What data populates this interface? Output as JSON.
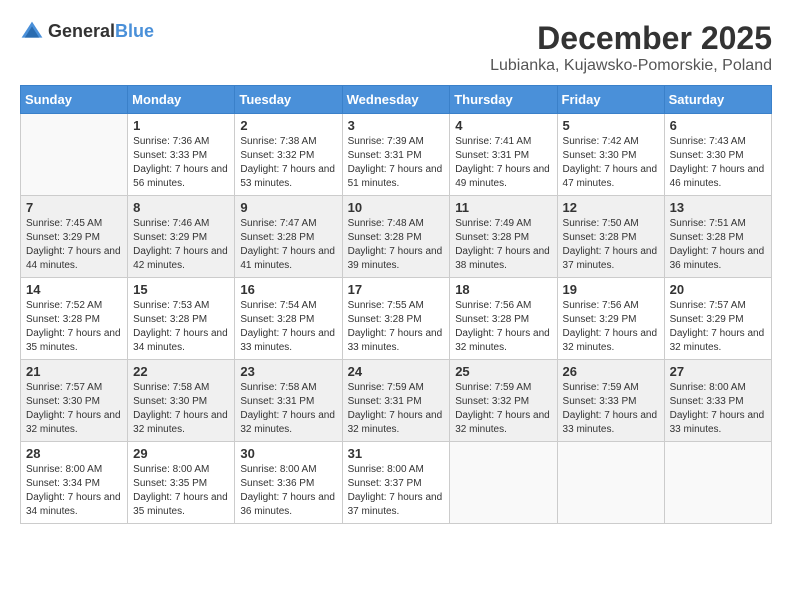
{
  "logo": {
    "general": "General",
    "blue": "Blue"
  },
  "title": "December 2025",
  "location": "Lubianka, Kujawsko-Pomorskie, Poland",
  "weekdays": [
    "Sunday",
    "Monday",
    "Tuesday",
    "Wednesday",
    "Thursday",
    "Friday",
    "Saturday"
  ],
  "weeks": [
    [
      {
        "day": null
      },
      {
        "day": 1,
        "sunrise": "Sunrise: 7:36 AM",
        "sunset": "Sunset: 3:33 PM",
        "daylight": "Daylight: 7 hours and 56 minutes."
      },
      {
        "day": 2,
        "sunrise": "Sunrise: 7:38 AM",
        "sunset": "Sunset: 3:32 PM",
        "daylight": "Daylight: 7 hours and 53 minutes."
      },
      {
        "day": 3,
        "sunrise": "Sunrise: 7:39 AM",
        "sunset": "Sunset: 3:31 PM",
        "daylight": "Daylight: 7 hours and 51 minutes."
      },
      {
        "day": 4,
        "sunrise": "Sunrise: 7:41 AM",
        "sunset": "Sunset: 3:31 PM",
        "daylight": "Daylight: 7 hours and 49 minutes."
      },
      {
        "day": 5,
        "sunrise": "Sunrise: 7:42 AM",
        "sunset": "Sunset: 3:30 PM",
        "daylight": "Daylight: 7 hours and 47 minutes."
      },
      {
        "day": 6,
        "sunrise": "Sunrise: 7:43 AM",
        "sunset": "Sunset: 3:30 PM",
        "daylight": "Daylight: 7 hours and 46 minutes."
      }
    ],
    [
      {
        "day": 7,
        "sunrise": "Sunrise: 7:45 AM",
        "sunset": "Sunset: 3:29 PM",
        "daylight": "Daylight: 7 hours and 44 minutes."
      },
      {
        "day": 8,
        "sunrise": "Sunrise: 7:46 AM",
        "sunset": "Sunset: 3:29 PM",
        "daylight": "Daylight: 7 hours and 42 minutes."
      },
      {
        "day": 9,
        "sunrise": "Sunrise: 7:47 AM",
        "sunset": "Sunset: 3:28 PM",
        "daylight": "Daylight: 7 hours and 41 minutes."
      },
      {
        "day": 10,
        "sunrise": "Sunrise: 7:48 AM",
        "sunset": "Sunset: 3:28 PM",
        "daylight": "Daylight: 7 hours and 39 minutes."
      },
      {
        "day": 11,
        "sunrise": "Sunrise: 7:49 AM",
        "sunset": "Sunset: 3:28 PM",
        "daylight": "Daylight: 7 hours and 38 minutes."
      },
      {
        "day": 12,
        "sunrise": "Sunrise: 7:50 AM",
        "sunset": "Sunset: 3:28 PM",
        "daylight": "Daylight: 7 hours and 37 minutes."
      },
      {
        "day": 13,
        "sunrise": "Sunrise: 7:51 AM",
        "sunset": "Sunset: 3:28 PM",
        "daylight": "Daylight: 7 hours and 36 minutes."
      }
    ],
    [
      {
        "day": 14,
        "sunrise": "Sunrise: 7:52 AM",
        "sunset": "Sunset: 3:28 PM",
        "daylight": "Daylight: 7 hours and 35 minutes."
      },
      {
        "day": 15,
        "sunrise": "Sunrise: 7:53 AM",
        "sunset": "Sunset: 3:28 PM",
        "daylight": "Daylight: 7 hours and 34 minutes."
      },
      {
        "day": 16,
        "sunrise": "Sunrise: 7:54 AM",
        "sunset": "Sunset: 3:28 PM",
        "daylight": "Daylight: 7 hours and 33 minutes."
      },
      {
        "day": 17,
        "sunrise": "Sunrise: 7:55 AM",
        "sunset": "Sunset: 3:28 PM",
        "daylight": "Daylight: 7 hours and 33 minutes."
      },
      {
        "day": 18,
        "sunrise": "Sunrise: 7:56 AM",
        "sunset": "Sunset: 3:28 PM",
        "daylight": "Daylight: 7 hours and 32 minutes."
      },
      {
        "day": 19,
        "sunrise": "Sunrise: 7:56 AM",
        "sunset": "Sunset: 3:29 PM",
        "daylight": "Daylight: 7 hours and 32 minutes."
      },
      {
        "day": 20,
        "sunrise": "Sunrise: 7:57 AM",
        "sunset": "Sunset: 3:29 PM",
        "daylight": "Daylight: 7 hours and 32 minutes."
      }
    ],
    [
      {
        "day": 21,
        "sunrise": "Sunrise: 7:57 AM",
        "sunset": "Sunset: 3:30 PM",
        "daylight": "Daylight: 7 hours and 32 minutes."
      },
      {
        "day": 22,
        "sunrise": "Sunrise: 7:58 AM",
        "sunset": "Sunset: 3:30 PM",
        "daylight": "Daylight: 7 hours and 32 minutes."
      },
      {
        "day": 23,
        "sunrise": "Sunrise: 7:58 AM",
        "sunset": "Sunset: 3:31 PM",
        "daylight": "Daylight: 7 hours and 32 minutes."
      },
      {
        "day": 24,
        "sunrise": "Sunrise: 7:59 AM",
        "sunset": "Sunset: 3:31 PM",
        "daylight": "Daylight: 7 hours and 32 minutes."
      },
      {
        "day": 25,
        "sunrise": "Sunrise: 7:59 AM",
        "sunset": "Sunset: 3:32 PM",
        "daylight": "Daylight: 7 hours and 32 minutes."
      },
      {
        "day": 26,
        "sunrise": "Sunrise: 7:59 AM",
        "sunset": "Sunset: 3:33 PM",
        "daylight": "Daylight: 7 hours and 33 minutes."
      },
      {
        "day": 27,
        "sunrise": "Sunrise: 8:00 AM",
        "sunset": "Sunset: 3:33 PM",
        "daylight": "Daylight: 7 hours and 33 minutes."
      }
    ],
    [
      {
        "day": 28,
        "sunrise": "Sunrise: 8:00 AM",
        "sunset": "Sunset: 3:34 PM",
        "daylight": "Daylight: 7 hours and 34 minutes."
      },
      {
        "day": 29,
        "sunrise": "Sunrise: 8:00 AM",
        "sunset": "Sunset: 3:35 PM",
        "daylight": "Daylight: 7 hours and 35 minutes."
      },
      {
        "day": 30,
        "sunrise": "Sunrise: 8:00 AM",
        "sunset": "Sunset: 3:36 PM",
        "daylight": "Daylight: 7 hours and 36 minutes."
      },
      {
        "day": 31,
        "sunrise": "Sunrise: 8:00 AM",
        "sunset": "Sunset: 3:37 PM",
        "daylight": "Daylight: 7 hours and 37 minutes."
      },
      {
        "day": null
      },
      {
        "day": null
      },
      {
        "day": null
      }
    ]
  ]
}
